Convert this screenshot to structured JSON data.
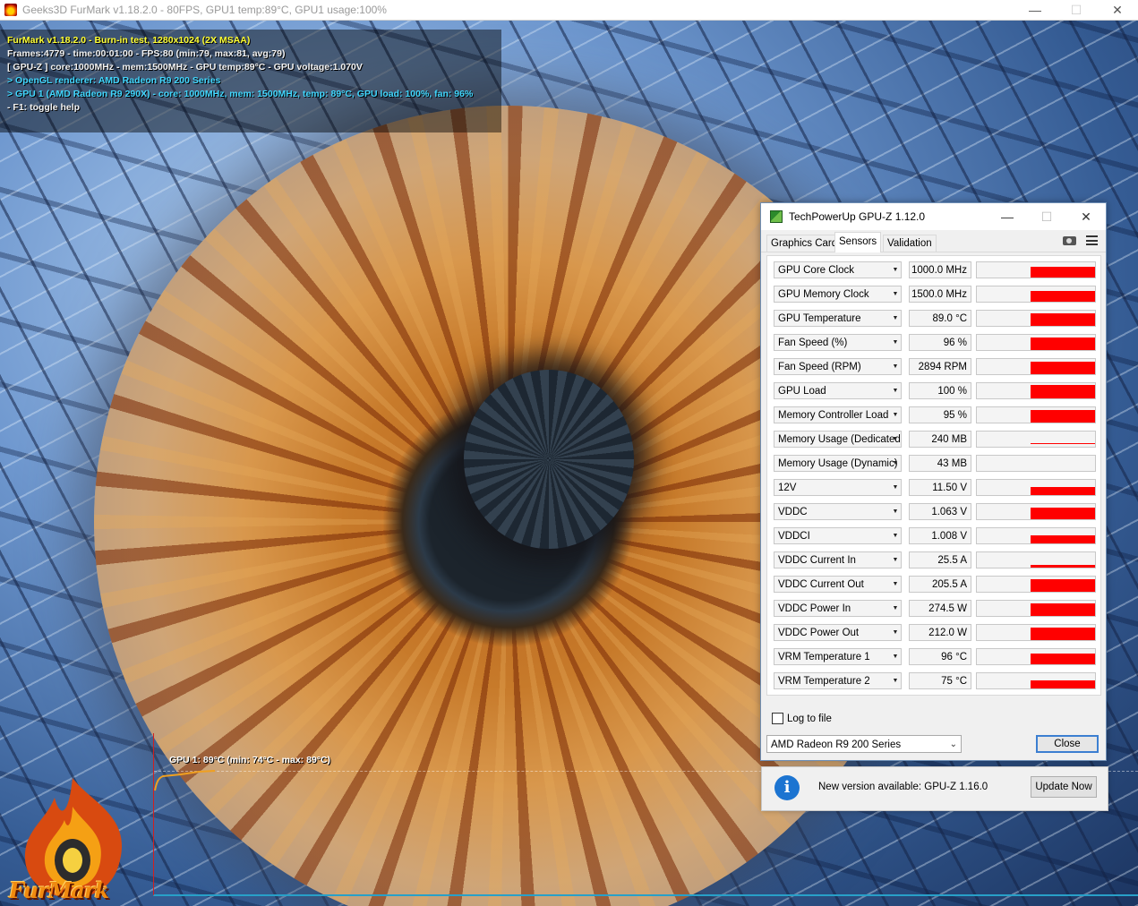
{
  "furmark": {
    "window_title": "Geeks3D FurMark v1.18.2.0 - 80FPS, GPU1 temp:89°C, GPU1 usage:100%",
    "hud": {
      "line1": "FurMark v1.18.2.0 - Burn-in test, 1280x1024 (2X MSAA)",
      "line2": "Frames:4779 - time:00:01:00 - FPS:80 (min:79, max:81, avg:79)",
      "line3": "[ GPU-Z ] core:1000MHz - mem:1500MHz - GPU temp:89°C - GPU voltage:1.070V",
      "line4": "> OpenGL renderer: AMD Radeon R9 200 Series",
      "line5": "> GPU 1 (AMD Radeon R9 290X) - core: 1000MHz, mem: 1500MHz, temp: 89°C, GPU load: 100%, fan: 96%",
      "line6": "- F1: toggle help"
    },
    "graph_label": "GPU 1: 89°C (min: 74°C - max: 89°C)",
    "logo_text": "FurMark"
  },
  "gpuz": {
    "title": "TechPowerUp GPU-Z 1.12.0",
    "tabs": {
      "graphics_card": "Graphics Card",
      "sensors": "Sensors",
      "validation": "Validation"
    },
    "sensors": [
      {
        "name": "GPU Core Clock",
        "value": "1000.0 MHz",
        "level": 0.7
      },
      {
        "name": "GPU Memory Clock",
        "value": "1500.0 MHz",
        "level": 0.7
      },
      {
        "name": "GPU Temperature",
        "value": "89.0 °C",
        "level": 0.8
      },
      {
        "name": "Fan Speed (%)",
        "value": "96 %",
        "level": 0.8
      },
      {
        "name": "Fan Speed (RPM)",
        "value": "2894 RPM",
        "level": 0.8
      },
      {
        "name": "GPU Load",
        "value": "100 %",
        "level": 0.9
      },
      {
        "name": "Memory Controller Load",
        "value": "95 %",
        "level": 0.85
      },
      {
        "name": "Memory Usage (Dedicated)",
        "value": "240 MB",
        "level": 0.05
      },
      {
        "name": "Memory Usage (Dynamic)",
        "value": "43 MB",
        "level": 0
      },
      {
        "name": "12V",
        "value": "11.50 V",
        "level": 0.55
      },
      {
        "name": "VDDC",
        "value": "1.063 V",
        "level": 0.75
      },
      {
        "name": "VDDCI",
        "value": "1.008 V",
        "level": 0.5
      },
      {
        "name": "VDDC Current In",
        "value": "25.5 A",
        "level": 0.2
      },
      {
        "name": "VDDC Current Out",
        "value": "205.5 A",
        "level": 0.8
      },
      {
        "name": "VDDC Power In",
        "value": "274.5 W",
        "level": 0.8
      },
      {
        "name": "VDDC Power Out",
        "value": "212.0 W",
        "level": 0.8
      },
      {
        "name": "VRM Temperature 1",
        "value": "96 °C",
        "level": 0.7
      },
      {
        "name": "VRM Temperature 2",
        "value": "75 °C",
        "level": 0.55
      }
    ],
    "log_to_file": "Log to file",
    "gpu_select": "AMD Radeon R9 200 Series",
    "close_label": "Close"
  },
  "update_notice": {
    "message": "New version available: GPU-Z 1.16.0",
    "button": "Update Now"
  },
  "colors": {
    "sensor_graph": "#ff0000",
    "hud_yellow": "#ffff33",
    "hud_cyan": "#41d7ff",
    "accent": "#3c7fd1"
  }
}
